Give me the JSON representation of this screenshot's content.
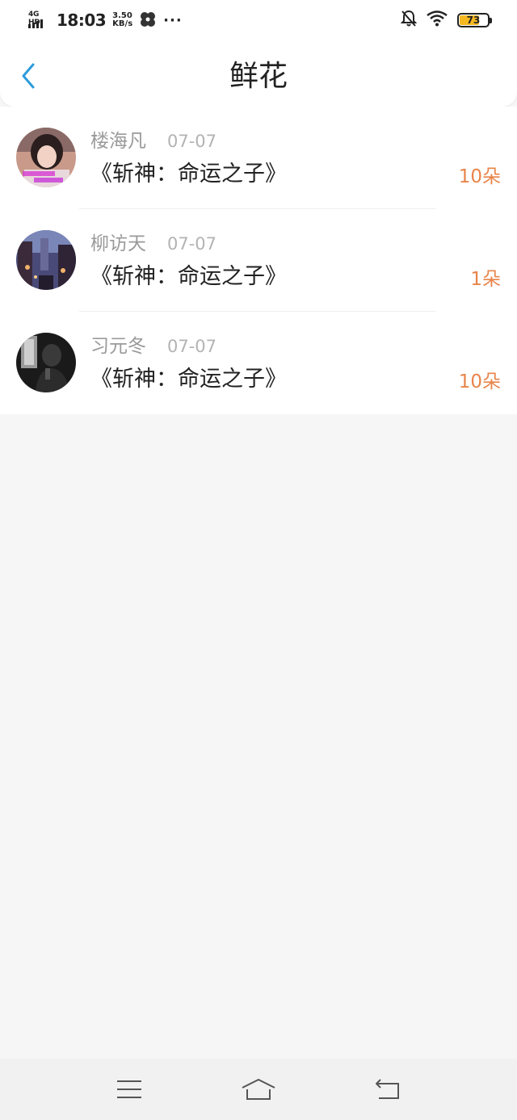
{
  "status_bar": {
    "network": "4G HD",
    "time": "18:03",
    "speed_value": "3.50",
    "speed_unit": "KB/s",
    "more": "···",
    "battery": "73",
    "battery_level": 0.73,
    "battery_color": "#f5b820"
  },
  "header": {
    "title": "鲜花",
    "back_icon": "chevron-left-icon",
    "accent_color": "#2d9cdb"
  },
  "gifts": [
    {
      "name": "楼海凡",
      "date": "07-07",
      "book": "《斩神：命运之子》",
      "flowers": "10朵",
      "avatar": "girl-portrait-avatar"
    },
    {
      "name": "柳访天",
      "date": "07-07",
      "book": "《斩神：命运之子》",
      "flowers": "1朵",
      "avatar": "night-street-avatar"
    },
    {
      "name": "习元冬",
      "date": "07-07",
      "book": "《斩神：命运之子》",
      "flowers": "10朵",
      "avatar": "man-silhouette-avatar"
    }
  ],
  "colors": {
    "flower_count": "#e8844a",
    "name_text": "#9a9a9a",
    "background": "#f7f6f7"
  },
  "nav": {
    "menu_icon": "menu-icon",
    "home_icon": "home-icon",
    "back_icon": "return-icon"
  }
}
